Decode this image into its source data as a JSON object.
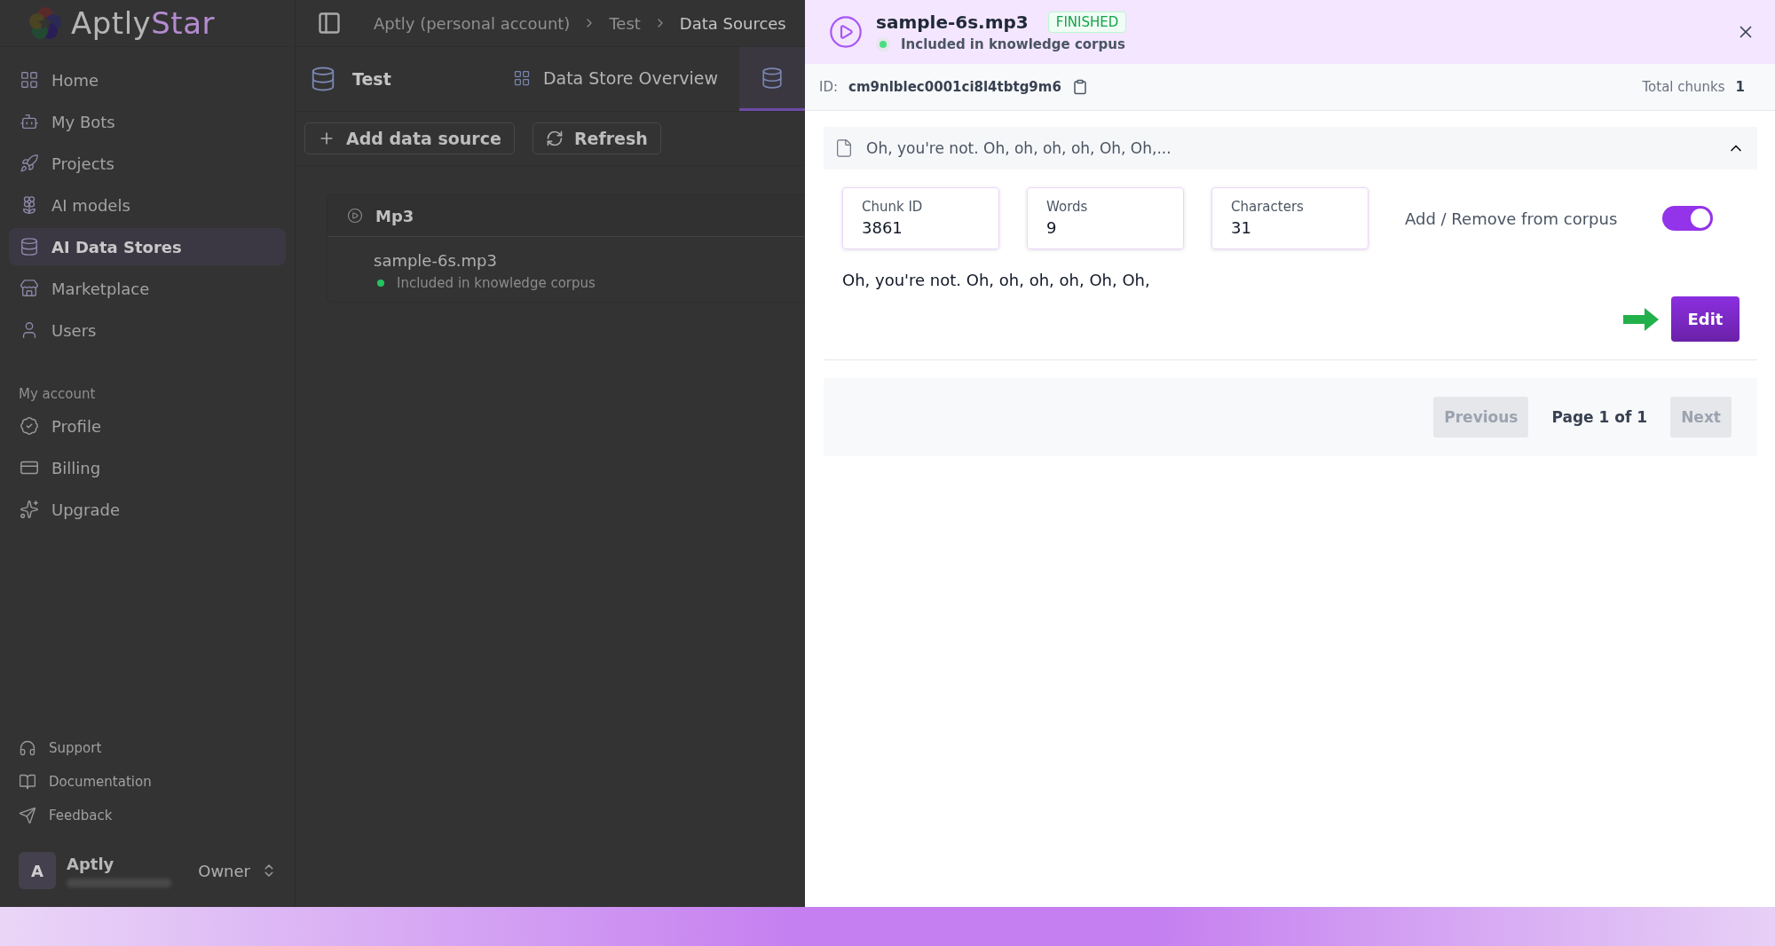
{
  "sidebar": {
    "logo": {
      "main": "Aptly",
      "accent": "Star"
    },
    "nav": [
      {
        "label": "Home",
        "selected": false
      },
      {
        "label": "My Bots",
        "selected": false
      },
      {
        "label": "Projects",
        "selected": false
      },
      {
        "label": "AI models",
        "selected": false
      },
      {
        "label": "AI Data Stores",
        "selected": true
      },
      {
        "label": "Marketplace",
        "selected": false
      },
      {
        "label": "Users",
        "selected": false
      }
    ],
    "account_heading": "My account",
    "account": [
      {
        "label": "Profile"
      },
      {
        "label": "Billing"
      },
      {
        "label": "Upgrade"
      }
    ],
    "footer_links": [
      {
        "label": "Support"
      },
      {
        "label": "Documentation"
      },
      {
        "label": "Feedback"
      }
    ],
    "user": {
      "initial": "A",
      "name": "Aptly",
      "role": "Owner"
    }
  },
  "main": {
    "breadcrumbs": [
      {
        "label": "Aptly (personal account)",
        "current": false
      },
      {
        "label": "Test",
        "current": false
      },
      {
        "label": "Data Sources",
        "current": true
      }
    ],
    "store_title": "Test",
    "tabs": [
      {
        "label": "Data Store Overview",
        "selected": false
      },
      {
        "selected": true
      }
    ],
    "buttons": [
      {
        "label": "Add data source",
        "kind": "add"
      },
      {
        "label": "Refresh",
        "kind": "refresh"
      }
    ],
    "group": {
      "title": "Mp3",
      "items": [
        {
          "name": "sample-6s.mp3",
          "status": "Included in knowledge corpus",
          "color": "#22c55e"
        }
      ]
    }
  },
  "panel": {
    "title": "sample-6s.mp3",
    "badge": "FINISHED",
    "status": "Included in knowledge corpus",
    "id_label": "ID:",
    "id": "cm9nlblec0001ci8l4tbtg9m6",
    "total_label": "Total chunks",
    "total": "1",
    "chunk": {
      "preview": "Oh, you're not. Oh, oh, oh, oh, Oh, Oh,...",
      "expanded": true,
      "stats": [
        {
          "label": "Chunk ID",
          "value": "3861"
        },
        {
          "label": "Words",
          "value": "9"
        },
        {
          "label": "Characters",
          "value": "31"
        }
      ],
      "toggle_label": "Add / Remove from corpus",
      "in_corpus": true,
      "text": "Oh, you're not. Oh, oh, oh, oh, Oh, Oh,",
      "edit": "Edit"
    },
    "pagination": {
      "previous": {
        "label": "Previous",
        "disabled": true
      },
      "page": "Page 1 of 1",
      "next": {
        "label": "Next",
        "disabled": true
      }
    }
  }
}
